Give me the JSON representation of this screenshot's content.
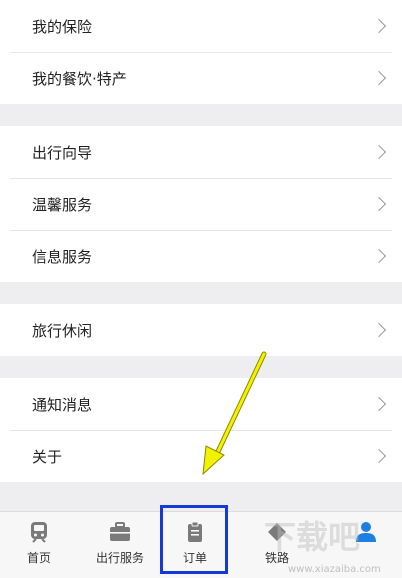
{
  "menu": {
    "group1": [
      {
        "label": "我的保险"
      },
      {
        "label": "我的餐饮·特产"
      }
    ],
    "group2": [
      {
        "label": "出行向导"
      },
      {
        "label": "温馨服务"
      },
      {
        "label": "信息服务"
      }
    ],
    "group3": [
      {
        "label": "旅行休闲"
      }
    ],
    "group4": [
      {
        "label": "通知消息"
      },
      {
        "label": "关于"
      }
    ]
  },
  "tabbar": {
    "tabs": [
      {
        "label": "首页",
        "icon": "train-icon"
      },
      {
        "label": "出行服务",
        "icon": "briefcase-icon"
      },
      {
        "label": "订单",
        "icon": "clipboard-icon"
      },
      {
        "label": "铁路",
        "icon": "diamond-icon"
      },
      {
        "label": "",
        "icon": "user-icon"
      }
    ]
  },
  "annotation": {
    "highlight_color": "#1538d8",
    "arrow_color": "#f2f200"
  },
  "watermark": {
    "text": "下载吧",
    "url": "www.xiazaiba.com"
  },
  "colors": {
    "background": "#eeeef0",
    "row": "#ffffff",
    "accent_user": "#1f7fe0"
  }
}
